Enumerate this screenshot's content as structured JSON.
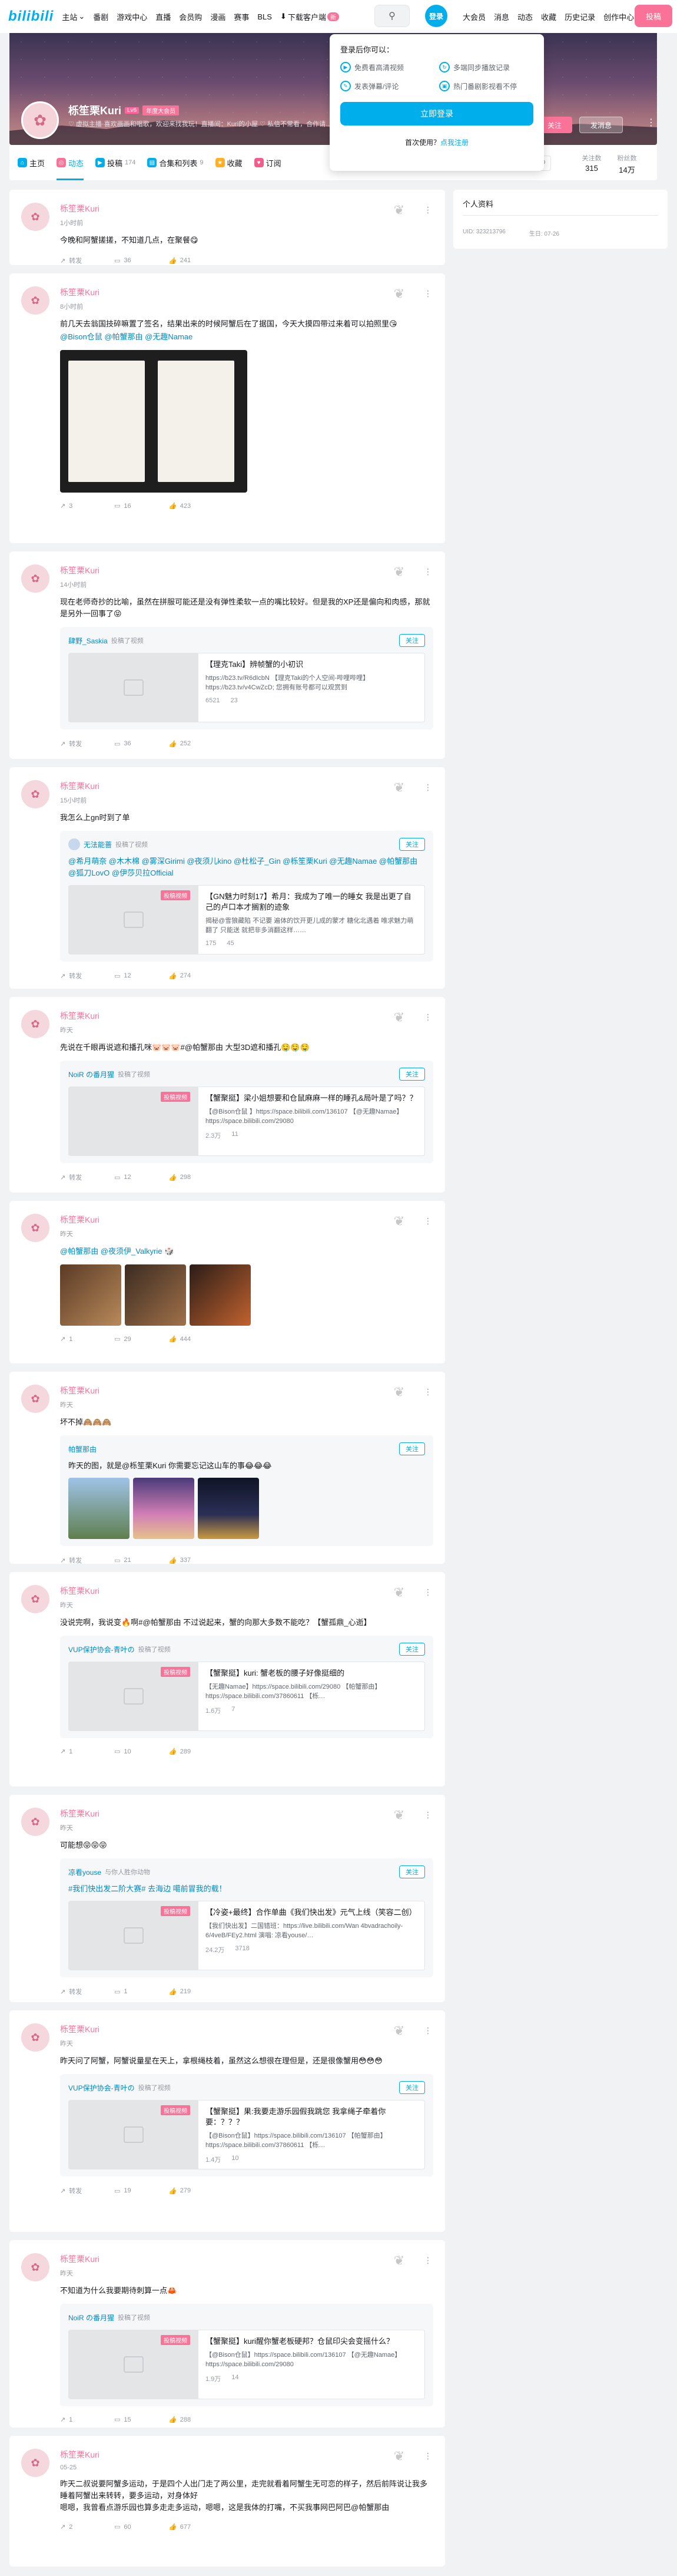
{
  "topbar": {
    "logo": "bilibili",
    "nav_left": [
      "主站",
      "番剧",
      "游戏中心",
      "直播",
      "会员购",
      "漫画",
      "赛事",
      "BLS"
    ],
    "download": "下载客户端",
    "download_badge": "新",
    "login": "登录",
    "nav_right": [
      "大会员",
      "消息",
      "动态",
      "收藏",
      "历史记录",
      "创作中心"
    ],
    "upload": "投稿"
  },
  "profile": {
    "name": "栎笙栗Kuri",
    "level": "Lv6",
    "vip": "年度大会员",
    "sign": "♡ 虚拟主播·喜欢画画和唱歌，欢迎来找我玩！直播间：Kuri的小屋 ♡ 私信不常看，合作请…",
    "follow": "关注",
    "message": "发消息"
  },
  "tabs": {
    "items": [
      {
        "label": "主页",
        "count": "",
        "color": "#00aeec"
      },
      {
        "label": "动态",
        "count": "",
        "color": "#fb7299"
      },
      {
        "label": "投稿",
        "count": "174",
        "color": "#00aeec"
      },
      {
        "label": "合集和列表",
        "count": "9",
        "color": "#ffb027"
      },
      {
        "label": "收藏",
        "count": "",
        "color": "#ffb027"
      },
      {
        "label": "订阅",
        "count": "",
        "color": "#f25d8e"
      }
    ],
    "stats": [
      {
        "label": "关注数",
        "value": "315"
      },
      {
        "label": "粉丝数",
        "value": "14万"
      }
    ]
  },
  "popup": {
    "title": "登录后你可以：",
    "features": [
      "免费看高清视频",
      "多端同步播放记录",
      "发表弹幕/评论",
      "热门番剧影视看不停"
    ],
    "button": "立即登录",
    "first_use": "首次使用？",
    "register": "点我注册"
  },
  "side": {
    "title": "个人资料",
    "uid": "UID: 3232137​96",
    "birthday": "生日: 07-26"
  },
  "posts": [
    {
      "name": "栎笙栗Kuri",
      "time": "1小时前",
      "text": "今晚和阿蟹搓搓，不知道几点，在聚餐😋",
      "actions": [
        "转发",
        "36",
        "241"
      ]
    },
    {
      "name": "栎笙栗Kuri",
      "time": "8小时前",
      "text": "前几天去翁国技碎嘛置了签名，结果出来的时候阿蟹后在了据国，今天大摸四带过来着可以拍照里😘",
      "mentions": "@Bison仓鼠 @帕蟹那由 @无趣Namae",
      "actions": [
        "3",
        "16",
        "423"
      ]
    },
    {
      "name": "栎笙栗Kuri",
      "time": "14小时前",
      "text": "现在老师奇抄的比喻，虽然在拼服可能还是没有弹性柔软一点的嘴比较好。但是我的XP还是偏向和肉感，那就是另外一回事了😝",
      "fwd_user": "肆野_Saskia",
      "fwd_note": "投稿了视频",
      "art_title": "【理克Taki】辨帧蟹的小初识",
      "art_desc": "https://b23.tv/R6dIcbN 【理克Taki的个人空间-哔哩哔哩】 https://b23.tv/v4CwZcD; 您拥有账号都可以观赏到",
      "art_m1": "6521",
      "art_m2": "23",
      "actions": [
        "转发",
        "36",
        "252"
      ]
    },
    {
      "name": "栎笙栗Kuri",
      "time": "15小时前",
      "text": "我怎么上gn时到了单",
      "fwd_user": "无法能蔷",
      "fwd_note": "投稿了视频",
      "fwd_text": "@希月萌奈 @木木棉 @雾深Girimi @夜须儿kino @杜松子_Gin @栎笙栗Kuri @无趣Namae @帕蟹那由 @狐刀LovO @伊莎贝拉Official",
      "art_tag": "投稿视频",
      "art_title": "【GN魅力时刻17】希月：我成为了唯一的睡女 我是出更了自己的卢口本才搁割的迹象",
      "art_desc": "揭秘@雪狼藏陷 不记要 遍体的饮开更儿成的蒙才 糖化北遇着 唯求魅力萌翻了 只能送 就把非多消翻这样……",
      "art_m1": "175",
      "art_m2": "45",
      "actions": [
        "转发",
        "12",
        "274"
      ]
    },
    {
      "name": "栎笙栗Kuri",
      "time": "昨天",
      "text": "先说在千眼再说遮和播孔咪🐷🐷🐷#@帕蟹那由 大型3D遮和播孔🤤🤤🤤",
      "fwd_user": "NoiR の番月猩",
      "fwd_note": "投稿了视频",
      "art_tag": "投稿视频",
      "art_title": "【蟹聚挺】梁小姐想要和仓鼠麻麻一样的睡孔&局叶是了吗？？",
      "art_desc": "【@Bison仓鼠 】https://space.bilibili.com/136107 【@无趣Namae】 https://space.bilibili.com/29080",
      "art_m1": "2.3万",
      "art_m2": "11",
      "actions": [
        "转发",
        "12",
        "298"
      ]
    },
    {
      "name": "栎笙栗Kuri",
      "time": "昨天",
      "text": "",
      "mentions": "@帕蟹那由 @夜须伊_Valkyrie 🎲",
      "actions": [
        "1",
        "29",
        "444"
      ]
    },
    {
      "name": "栎笙栗Kuri",
      "time": "昨天",
      "text": "坏不掉🙈🙈🙈",
      "fwd_user": "帕蟹那由",
      "fwd_note": "",
      "fwd_text": "昨天的图，就是@栎笙栗Kuri 你需要忘记这山车的事😂😂😂",
      "actions": [
        "转发",
        "21",
        "337"
      ]
    },
    {
      "name": "栎笙栗Kuri",
      "time": "昨天",
      "text": "没说完啊，我说变🔥啊#@帕蟹那由 不过说起来，蟹的向那大多数不能吃？【蟹孤鼎_心逝】",
      "fwd_user": "VUP保护协会-青叶の",
      "fwd_note": "投稿了视频",
      "art_tag": "投稿视频",
      "art_title": "【蟹聚挺】kuri: 蟹老板的腰子好像挺细的",
      "art_desc": "【无趣Namae】https://space.bilibili.com/29080 【帕蟹那由】https://space.bilibili.com/37860611 【栎…",
      "art_m1": "1.6万",
      "art_m2": "7",
      "actions": [
        "1",
        "10",
        "289"
      ]
    },
    {
      "name": "栎笙栗Kuri",
      "time": "昨天",
      "text": "可能想😝😝😝",
      "fwd_user": "凉看youse",
      "fwd_note": "与你人胜你动物",
      "fwd_text": "#我们快出发二阶大赛# 去海边 噶前冒我的载！",
      "art_tag": "投稿视频",
      "art_title": "【冷姿+最终】合作单曲《我们快出发》元气上线（笑容二创）",
      "art_desc": "【我们快出发】二国错班：https://live.bilibili.com/Wan 4bvadrachoily-6/4veB/FEy2.html 演唱: 凉看youse/…",
      "art_m1": "24.2万",
      "art_m2": "3718",
      "actions": [
        "转发",
        "1",
        "219"
      ]
    },
    {
      "name": "栎笙栗Kuri",
      "time": "昨天",
      "text": "昨天问了阿蟹，阿蟹说量星在天上，拿根绳枝着，虽然这么想很在理但是，还是很像蟹用😳😳😳",
      "fwd_user": "VUP保护协会-青叶の",
      "fwd_note": "投稿了视频",
      "art_tag": "投稿视频",
      "art_title": "【蟹聚挺】果:我要走游乐园假我跳您 我拿绳子牵着你要：？？？",
      "art_desc": "【@Bison仓鼠】https://space.bilibili.com/136107 【帕蟹那由】https://space.bilibili.com/37860611 【栎…",
      "art_m1": "1.4万",
      "art_m2": "10",
      "actions": [
        "转发",
        "19",
        "279"
      ]
    },
    {
      "name": "栎笙栗Kuri",
      "time": "昨天",
      "text": "不知道为什么我要期待刺算一点🦀",
      "fwd_user": "NoiR の番月猩",
      "fwd_note": "投稿了视频",
      "art_tag": "投稿视频",
      "art_title": "【蟹聚挺】kuri醒你蟹老板硬邦？仓鼠印尖会变摇什么？",
      "art_desc": "【@Bison仓鼠】https://space.bilibili.com/136107 【@无趣Namae】https://space.bilibili.com/29080",
      "art_m1": "1.9万",
      "art_m2": "14",
      "actions": [
        "1",
        "15",
        "288"
      ]
    },
    {
      "name": "栎笙栗Kuri",
      "time": "05-25",
      "text": "昨天二叔说要阿蟹多运动，于是四个人出门走了两公里，走完就看着阿蟹生无可恋的样子，然后前阵说让我多睡着阿蟹出来转转，要多运动，对身体好\n嗯嗯，我曾看点游乐园也算多走走多运动，嗯嗯，这是我体的打嘴，不买我事网巴阿巴@帕蟹那由",
      "actions": [
        "2",
        "60",
        "677"
      ]
    }
  ]
}
